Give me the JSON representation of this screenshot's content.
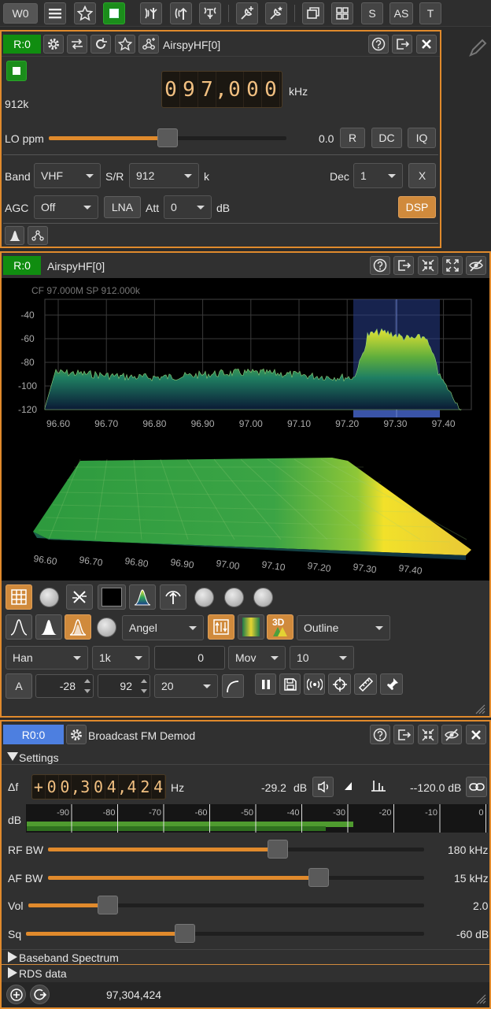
{
  "toolbar": {
    "workspace_label": "W0",
    "buttons": [
      "menu-icon",
      "star-icon",
      "stop-icon",
      "rx-icon",
      "tx-icon",
      "mimo-icon",
      "add-feature-icon",
      "add-feature-star-icon",
      "window-icon",
      "grid-icon"
    ],
    "s_label": "S",
    "as_label": "AS",
    "t_label": "T"
  },
  "device": {
    "badge": "R:0",
    "name": "AirspyHF[0]",
    "frequency_digits": "097,000",
    "frequency_unit": "kHz",
    "sample_rate_label": "912k",
    "lo_ppm_label": "LO ppm",
    "lo_ppm_value": "0.0",
    "lo_ppm_fraction": 0.5,
    "r_label": "R",
    "dc_label": "DC",
    "iq_label": "IQ",
    "band_label": "Band",
    "band_value": "VHF",
    "sr_label": "S/R",
    "sr_value": "912",
    "sr_unit": "k",
    "dec_label": "Dec",
    "dec_value": "1",
    "x_label": "X",
    "agc_label": "AGC",
    "agc_value": "Off",
    "lna_label": "LNA",
    "att_label": "Att",
    "att_value": "0",
    "att_unit": "dB",
    "dsp_label": "DSP"
  },
  "spectrum": {
    "badge": "R:0",
    "name": "AirspyHF[0]",
    "info": "CF 97.000M SP 912.000k",
    "y_ticks": [
      "-40",
      "-60",
      "-80",
      "-100",
      "-120"
    ],
    "x_ticks": [
      "96.60",
      "96.70",
      "96.80",
      "96.90",
      "97.00",
      "97.10",
      "97.20",
      "97.30",
      "97.40"
    ],
    "x3d_ticks": [
      "96.60",
      "96.70",
      "96.80",
      "96.90",
      "97.00",
      "97.10",
      "97.20",
      "97.30",
      "97.40"
    ],
    "colormap_value": "Angel",
    "outline_value": "Outline",
    "window_value": "Han",
    "fft_size_value": "1k",
    "overlap_value": "0",
    "avg_mode_value": "Mov",
    "avg_value": "10",
    "a_label": "A",
    "ref_value": "-28",
    "range_value": "92",
    "fps_value": "20",
    "label_3d": "3D",
    "colors": {
      "accent": "#e08a2c",
      "badge": "#108d10",
      "highlight": "#3a54a8"
    }
  },
  "demod": {
    "badge": "R0:0",
    "title": "Broadcast FM Demod",
    "settings_label": "Settings",
    "delta_f_label": "Δf",
    "delta_f_digits": "+00,304,424",
    "hz_label": "Hz",
    "power_value": "-29.2",
    "power_unit": "dB",
    "squelch_db_value": "--120.0 dB",
    "db_label": "dB",
    "meter_ticks": [
      "-90",
      "-80",
      "-70",
      "-60",
      "-50",
      "-40",
      "-30",
      "-20",
      "-10",
      "0"
    ],
    "meter_level_fraction": 0.71,
    "rfbw_label": "RF BW",
    "rfbw_value": "180 kHz",
    "rfbw_fraction": 0.61,
    "afbw_label": "AF BW",
    "afbw_value": "15 kHz",
    "afbw_fraction": 0.72,
    "vol_label": "Vol",
    "vol_value": "2.0",
    "vol_fraction": 0.2,
    "sq_label": "Sq",
    "sq_value": "-60 dB",
    "sq_fraction": 0.4,
    "baseband_label": "Baseband Spectrum",
    "rds_label": "RDS data",
    "frequency_value": "97,304,424"
  }
}
